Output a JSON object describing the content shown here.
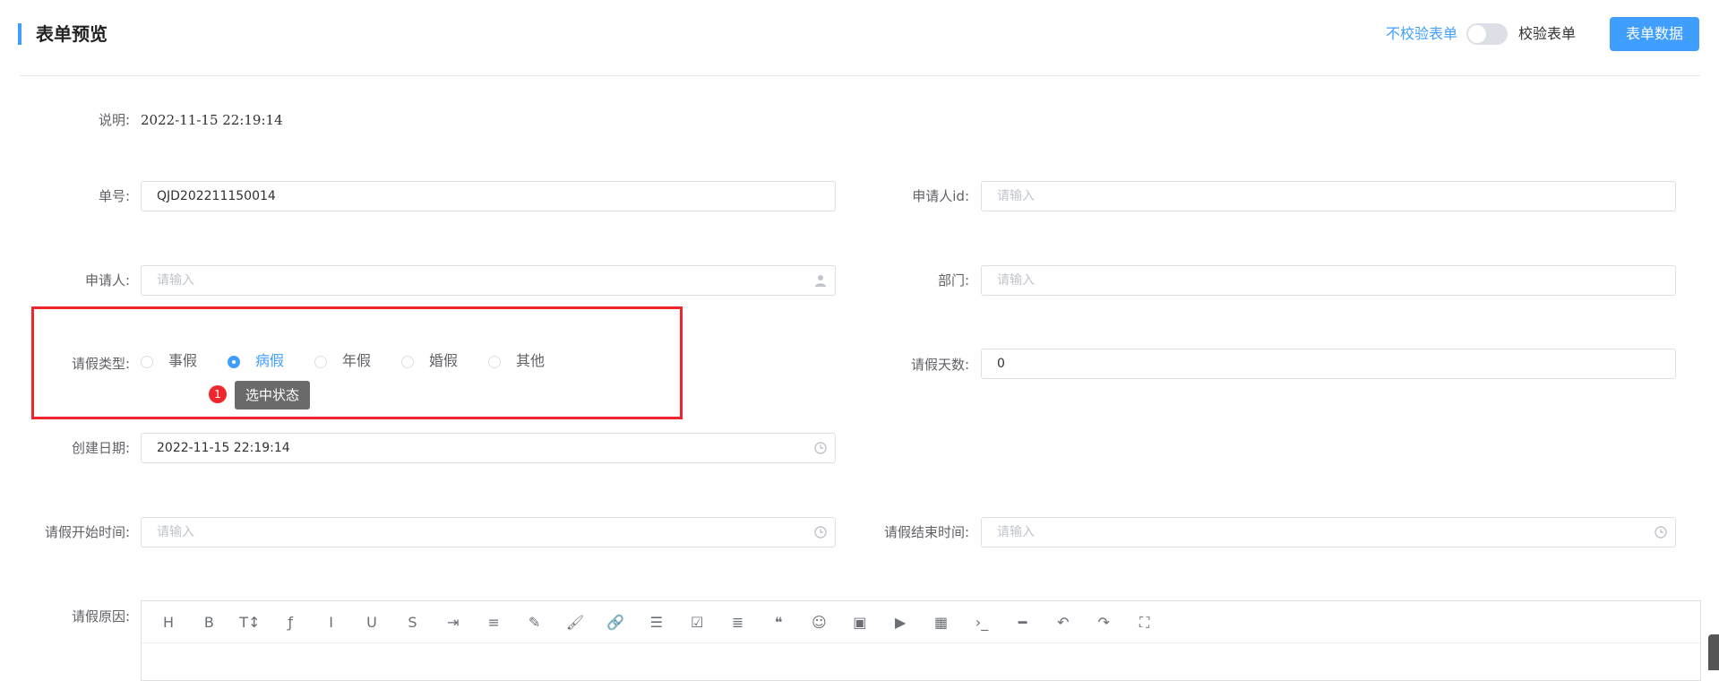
{
  "header": {
    "title": "表单预览",
    "no_validate_label": "不校验表单",
    "validate_label": "校验表单",
    "validate_switch_on": false,
    "form_data_button": "表单数据"
  },
  "form": {
    "description_label": "说明:",
    "description_value": "2022-11-15 22:19:14",
    "order_no_label": "单号:",
    "order_no_value": "QJD202211150014",
    "applicant_id_label": "申请人id:",
    "applicant_id_placeholder": "请输入",
    "applicant_label": "申请人:",
    "applicant_placeholder": "请输入",
    "department_label": "部门:",
    "department_placeholder": "请输入",
    "leave_type_label": "请假类型:",
    "leave_types": [
      {
        "label": "事假",
        "selected": false
      },
      {
        "label": "病假",
        "selected": true
      },
      {
        "label": "年假",
        "selected": false
      },
      {
        "label": "婚假",
        "selected": false
      },
      {
        "label": "其他",
        "selected": false
      }
    ],
    "leave_days_label": "请假天数:",
    "leave_days_value": "0",
    "created_date_label": "创建日期:",
    "created_date_value": "2022-11-15 22:19:14",
    "start_time_label": "请假开始时间:",
    "start_time_placeholder": "请输入",
    "end_time_label": "请假结束时间:",
    "end_time_placeholder": "请输入",
    "reason_label": "请假原因:"
  },
  "annotation": {
    "badge": "1",
    "tooltip": "选中状态"
  },
  "editor_toolbar": [
    {
      "icon": "heading-icon",
      "glyph": "H"
    },
    {
      "icon": "bold-icon",
      "glyph": "B"
    },
    {
      "icon": "text-size-icon",
      "glyph": "T↕"
    },
    {
      "icon": "font-icon",
      "glyph": "ƒ"
    },
    {
      "icon": "italic-icon",
      "glyph": "I"
    },
    {
      "icon": "underline-icon",
      "glyph": "U"
    },
    {
      "icon": "strikethrough-icon",
      "glyph": "S"
    },
    {
      "icon": "indent-icon",
      "glyph": "⇥"
    },
    {
      "icon": "align-icon",
      "glyph": "≡"
    },
    {
      "icon": "pen-icon",
      "glyph": "✎"
    },
    {
      "icon": "brush-icon",
      "glyph": "🖌"
    },
    {
      "icon": "link-icon",
      "glyph": "🔗"
    },
    {
      "icon": "list-icon",
      "glyph": "☰"
    },
    {
      "icon": "checkbox-icon",
      "glyph": "☑"
    },
    {
      "icon": "align-left-icon",
      "glyph": "≣"
    },
    {
      "icon": "quote-icon",
      "glyph": "❝"
    },
    {
      "icon": "emoji-icon",
      "glyph": "☺"
    },
    {
      "icon": "image-icon",
      "glyph": "▣"
    },
    {
      "icon": "video-icon",
      "glyph": "▶"
    },
    {
      "icon": "table-icon",
      "glyph": "▦"
    },
    {
      "icon": "code-icon",
      "glyph": "›_"
    },
    {
      "icon": "horizontal-rule-icon",
      "glyph": "━"
    },
    {
      "icon": "undo-icon",
      "glyph": "↶"
    },
    {
      "icon": "redo-icon",
      "glyph": "↷"
    },
    {
      "icon": "fullscreen-icon",
      "glyph": "⛶"
    }
  ],
  "colors": {
    "accent": "#409eff",
    "highlight_border": "#f0262d",
    "badge": "#f0262d",
    "tooltip_bg": "#6a6a6a"
  }
}
